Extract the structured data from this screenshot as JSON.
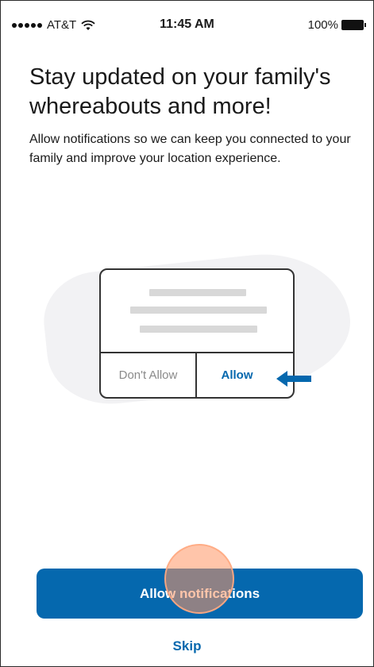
{
  "status_bar": {
    "carrier": "AT&T",
    "time": "11:45 AM",
    "battery": "100%"
  },
  "headline": "Stay updated on your family's whereabouts and more!",
  "description": "Allow notifications so we can keep you connected to your family and improve your location experience.",
  "illustration": {
    "dont_allow_label": "Don't Allow",
    "allow_label": "Allow"
  },
  "primary_button": "Allow notifications",
  "skip_link": "Skip",
  "colors": {
    "accent": "#0568ae"
  }
}
